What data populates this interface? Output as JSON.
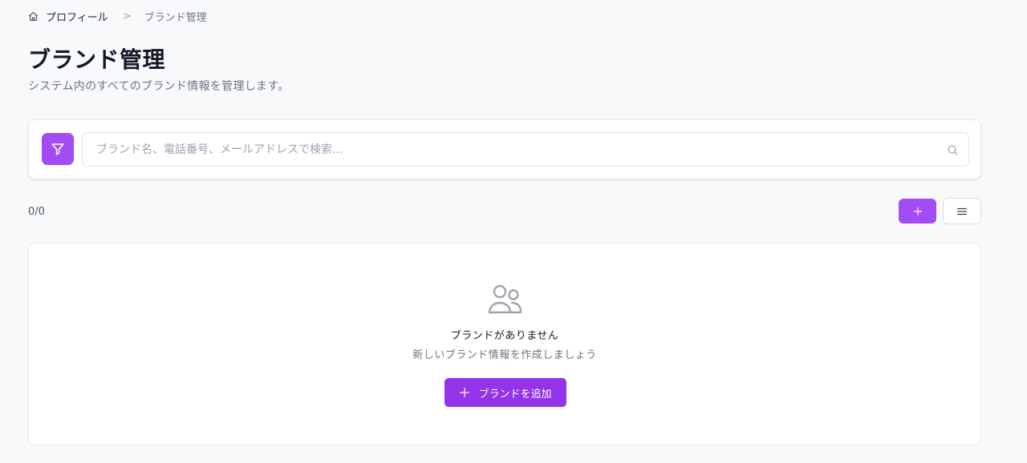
{
  "breadcrumb": {
    "items": [
      "プロフィール",
      "ブランド管理"
    ],
    "separator": ">"
  },
  "header": {
    "title": "ブランド管理",
    "subtitle": "システム内のすべてのブランド情報を管理します。"
  },
  "search": {
    "placeholder": "ブランド名、電話番号、メールアドレスで検索...",
    "value": ""
  },
  "list": {
    "count": "0/0"
  },
  "empty_state": {
    "title": "ブランドがありません",
    "description": "新しいブランド情報を作成しましょう",
    "button_label": "ブランドを追加"
  },
  "icons": {
    "home": "home-icon",
    "filter": "filter-icon",
    "search": "search-icon",
    "add": "plus-icon",
    "menu": "menu-icon",
    "empty": "users-icon"
  },
  "colors": {
    "accent": "#a24cf5",
    "primary_button": "#9333ea",
    "background": "#f8f9fb"
  }
}
